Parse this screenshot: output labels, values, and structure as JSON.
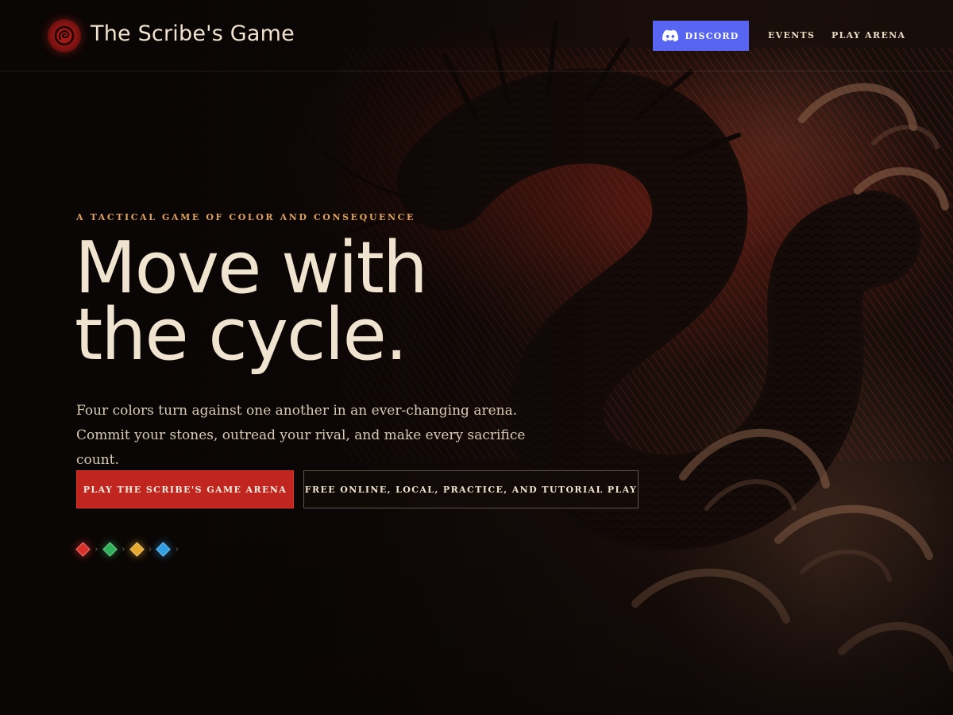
{
  "header": {
    "brand": "The Scribe's Game",
    "discord_label": "DISCORD",
    "nav": {
      "events": "EVENTS",
      "play_arena": "PLAY ARENA"
    }
  },
  "hero": {
    "eyebrow": "A TACTICAL GAME OF COLOR AND CONSEQUENCE",
    "headline_line1": "Move with",
    "headline_line2": "the cycle.",
    "lede": "Four colors turn against one another in an ever-changing arena. Commit your stones, outread your rival, and make every sacrifice count.",
    "primary_cta": "PLAY THE SCRIBE'S GAME ARENA",
    "secondary_cta": "FREE ONLINE, LOCAL, PRACTICE, AND TUTORIAL PLAY"
  },
  "color_cycle": [
    {
      "name": "red",
      "color": "#d9302a"
    },
    {
      "name": "green",
      "color": "#2fb15a"
    },
    {
      "name": "gold",
      "color": "#e5a92e"
    },
    {
      "name": "blue",
      "color": "#2f9ee5"
    }
  ],
  "colors": {
    "background": "#0c0807",
    "text": "#f0e3cf",
    "accent_eyebrow": "#e0a25a",
    "primary_button": "#c0261f",
    "discord": "#5865f2"
  },
  "icons": {
    "logo": "scribe-seal-icon",
    "discord": "discord-icon",
    "cycle_separator": "chevron-right-icon"
  }
}
